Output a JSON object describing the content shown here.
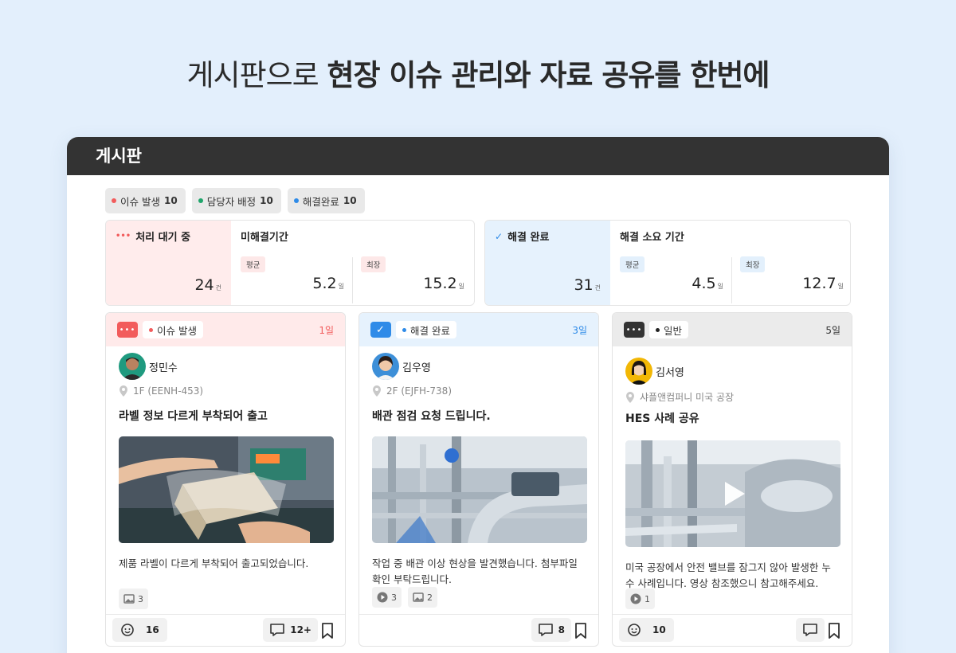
{
  "headline": {
    "light": "게시판으로 ",
    "bold": "현장 이슈 관리와 자료 공유를 한번에"
  },
  "board": {
    "title": "게시판",
    "chips": [
      {
        "label": "이슈 발생",
        "count": "10",
        "color": "#f25c5c"
      },
      {
        "label": "담당자 배정",
        "count": "10",
        "color": "#1fa56b"
      },
      {
        "label": "해결완료",
        "count": "10",
        "color": "#2f8be8"
      }
    ],
    "stats_pending": {
      "label": "처리 대기 중",
      "count": "24",
      "unit": "건",
      "detail_title": "미해결기간",
      "avg_label": "평균",
      "avg_value": "5.2",
      "max_label": "최장",
      "max_value": "15.2",
      "day_unit": "일"
    },
    "stats_resolved": {
      "label": "해결 완료",
      "count": "31",
      "unit": "건",
      "detail_title": "해결 소요 기간",
      "avg_label": "평균",
      "avg_value": "4.5",
      "max_label": "최장",
      "max_value": "12.7",
      "day_unit": "일"
    },
    "cards": [
      {
        "status": "이슈 발생",
        "days": "1일",
        "author": "정민수",
        "location": "1F (EENH-453)",
        "title": "라벨 정보 다르게 부착되어 출고",
        "desc": "제품 라벨이 다르게 부착되어 출고되었습니다.",
        "image_count": "3",
        "reactions": "16",
        "comments": "12+"
      },
      {
        "status": "해결 완료",
        "days": "3일",
        "author": "김우영",
        "location": "2F (EJFH-738)",
        "title": "배관 점검 요청 드립니다.",
        "desc": "작업 중 배관 이상 현상을 발견했습니다. 첨부파일 확인 부탁드립니다.",
        "video_count": "3",
        "image_count": "2",
        "comments": "8"
      },
      {
        "status": "일반",
        "days": "5일",
        "author": "김서영",
        "location": "샤플앤컴퍼니 미국 공장",
        "title": "HES 사례 공유",
        "desc": "미국 공장에서 안전 밸브를 잠그지 않아 발생한 누수 사례입니다. 영상 참조했으니 참고해주세요.",
        "video_count": "1",
        "reactions": "10"
      }
    ],
    "colors": {
      "issue": "#f25c5c",
      "resolved": "#2f8be8",
      "general": "#333333",
      "assigned": "#1fa56b"
    }
  }
}
